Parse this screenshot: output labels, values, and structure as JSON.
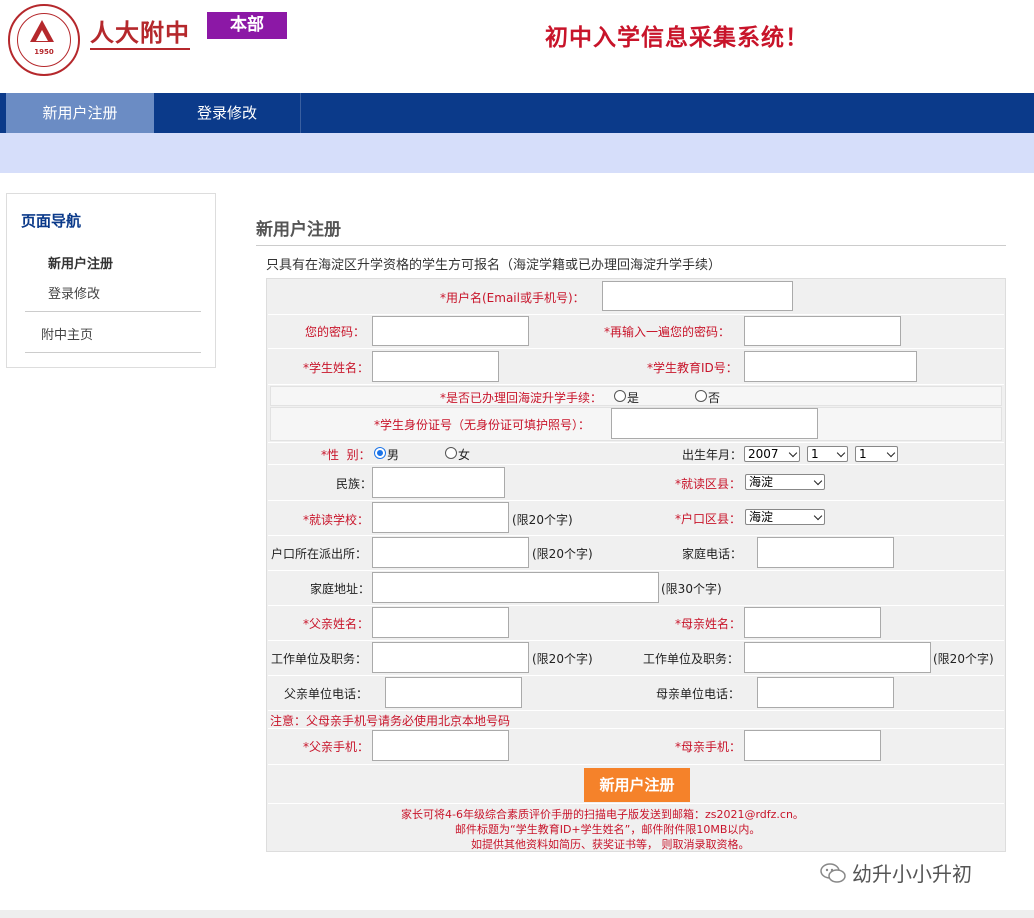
{
  "header": {
    "logo_year": "1950",
    "logo_name": "人大附中",
    "badge": "本部",
    "system_title": "初中入学信息采集系统！"
  },
  "nav": {
    "tabs": [
      {
        "label": "新用户注册",
        "active": true
      },
      {
        "label": "登录修改",
        "active": false
      }
    ]
  },
  "sidebar": {
    "title": "页面导航",
    "items": [
      "新用户注册",
      "登录修改",
      "附中主页"
    ]
  },
  "main": {
    "title": "新用户注册",
    "intro": "只具有在海淀区升学资格的学生方可报名（海淀学籍或已办理回海淀升学手续）"
  },
  "form": {
    "username_label": "*用户名(Email或手机号)：",
    "password_label": "您的密码：",
    "password_confirm_label": "*再输入一遍您的密码：",
    "student_name_label": "*学生姓名：",
    "student_id_label": "*学生教育ID号：",
    "transfer_label": "*是否已办理回海淀升学手续：",
    "yes": "是",
    "no": "否",
    "idcard_label": "*学生身份证号（无身份证可填护照号）：",
    "gender_label": "*性  别：",
    "male": "男",
    "female": "女",
    "birth_label": "出生年月：",
    "birth_year": "2007",
    "birth_month": "1",
    "birth_day": "1",
    "ethnicity_label": "民族：",
    "district_label": "*就读区县：",
    "district_value": "海淀",
    "school_label": "*就读学校：",
    "limit20": "(限20个字)",
    "hukou_district_label": "*户口区县：",
    "hukou_district_value": "海淀",
    "police_label": "户口所在派出所：",
    "home_phone_label": "家庭电话：",
    "address_label": "家庭地址：",
    "limit30": "(限30个字)",
    "father_name_label": "*父亲姓名：",
    "mother_name_label": "*母亲姓名：",
    "father_work_label": "工作单位及职务：",
    "mother_work_label": "工作单位及职务：",
    "father_work_phone_label": "父亲单位电话：",
    "mother_work_phone_label": "母亲单位电话：",
    "phone_note": "注意：父母亲手机号请务必使用北京本地号码",
    "father_mobile_label": "*父亲手机：",
    "mother_mobile_label": "*母亲手机：",
    "submit": "新用户注册",
    "notes": [
      "家长可将4-6年级综合素质评价手册的扫描电子版发送到邮箱：zs2021@rdfz.cn。",
      "邮件标题为“学生教育ID+学生姓名”，邮件附件限10MB以内。",
      "如提供其他资料如简历、获奖证书等， 则取消录取资格。"
    ]
  },
  "watermark": "幼升小小升初"
}
